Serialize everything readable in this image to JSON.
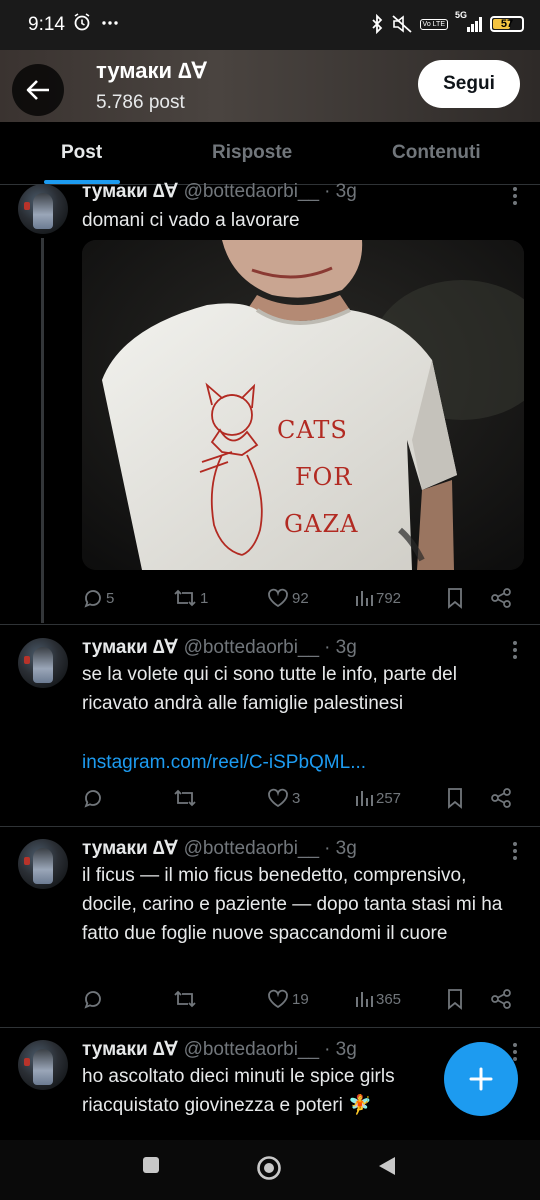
{
  "status_bar": {
    "time": "9:14",
    "battery": "57",
    "network": "5G",
    "volte": "Vo LTE",
    "icons": [
      "alarm-icon",
      "overflow-dots-icon",
      "bluetooth-icon",
      "mute-icon",
      "signal-icon",
      "battery-icon"
    ]
  },
  "header": {
    "name": "тумаки ∆∀",
    "post_count": "5.786 post",
    "follow_label": "Segui"
  },
  "tabs": [
    {
      "label": "Post",
      "active": true
    },
    {
      "label": "Risposte",
      "active": false
    },
    {
      "label": "Contenuti",
      "active": false
    }
  ],
  "tweets": [
    {
      "name": "тумаки ∆∀",
      "handle": "@bottedaorbi__",
      "time": "· 3g",
      "text": "domani ci vado a lavorare",
      "image": {
        "shirt_text": [
          "CATS",
          "FOR",
          "GAZA"
        ]
      },
      "replies": "5",
      "retweets": "1",
      "likes": "92",
      "views": "792"
    },
    {
      "name": "тумаки ∆∀",
      "handle": "@bottedaorbi__",
      "time": "· 3g",
      "text": "se la volete qui ci sono tutte le info, parte del ricavato andrà alle famiglie palestinesi",
      "link": "instagram.com/reel/C-iSPbQML...",
      "replies": "",
      "retweets": "",
      "likes": "3",
      "views": "257"
    },
    {
      "name": "тумаки ∆∀",
      "handle": "@bottedaorbi__",
      "time": "· 3g",
      "text": "il ficus — il mio ficus benedetto, comprensivo, docile, carino e paziente — dopo tanta stasi mi ha fatto due foglie nuove spaccandomi il cuore",
      "replies": "",
      "retweets": "",
      "likes": "19",
      "views": "365"
    },
    {
      "name": "тумаки ∆∀",
      "handle": "@bottedaorbi__",
      "time": "· 3g",
      "text": "ho ascoltato dieci minuti le spice girls",
      "text2": "riacquistato giovinezza e poteri 🧚"
    }
  ],
  "colors": {
    "accent": "#1d9bf0",
    "muted": "#71767b",
    "text": "#e7e9ea",
    "background": "#000000"
  }
}
